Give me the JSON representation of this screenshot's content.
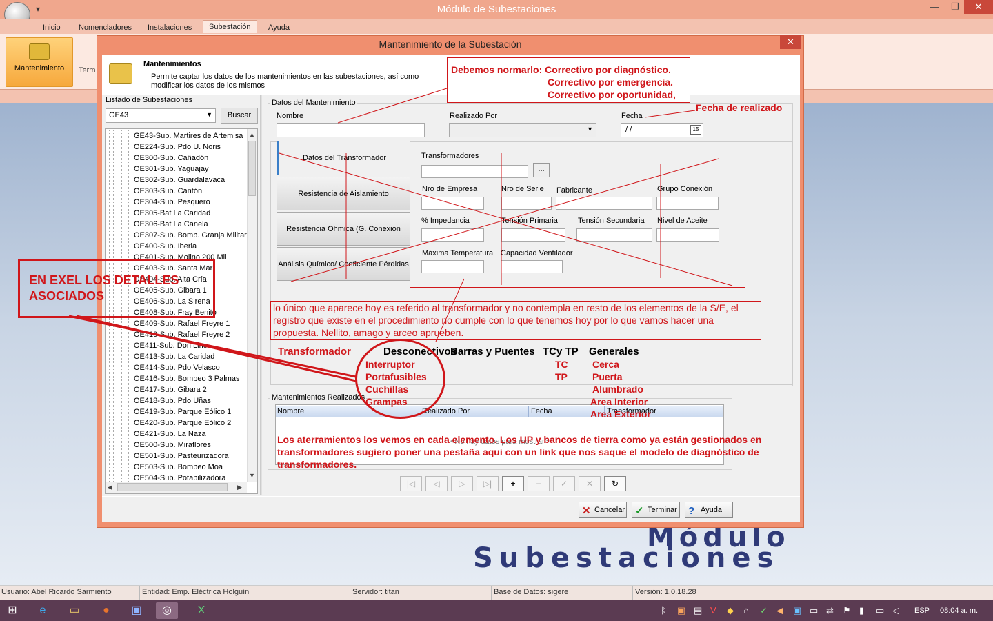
{
  "app": {
    "title": "Módulo de Subestaciones",
    "qat": "▾",
    "ribbon_tabs": [
      "Inicio",
      "Nomencladores",
      "Instalaciones",
      "Subestación",
      "Ayuda"
    ],
    "active_tab": "Subestación",
    "ribbon_buttons": {
      "mantenimiento": "Mantenimiento",
      "term": "Term"
    }
  },
  "dialog": {
    "title": "Mantenimiento de la Subestación",
    "header_title": "Mantenimientos",
    "header_desc": "Permite captar los datos de los mantenimientos en las subestaciones, así como modificar los datos de los mismos",
    "list_label": "Listado de Subestaciones",
    "selected_substation": "GE43",
    "search_button": "Buscar",
    "substations": [
      "GE43-Sub. Martires de Artemisa",
      "OE224-Sub. Pdo U. Noris",
      "OE300-Sub. Cañadón",
      "OE301-Sub. Yaguajay",
      "OE302-Sub. Guardalavaca",
      "OE303-Sub. Cantón",
      "OE304-Sub. Pesquero",
      "OE305-Bat La Caridad",
      "OE306-Bat La Canela",
      "OE307-Sub. Bomb. Granja Militar",
      "OE400-Sub. Iberia",
      "OE401-Sub. Molino 200 Mil",
      "OE403-Sub. Santa Marí",
      "OE404-Sub. Alta Cría",
      "OE405-Sub. Gibara 1",
      "OE406-Sub. La Sirena",
      "OE408-Sub. Fray Benito",
      "OE409-Sub. Rafael Freyre 1",
      "OE410-Sub. Rafael Freyre 2",
      "OE411-Sub. Don Lino",
      "OE413-Sub. La Caridad",
      "OE414-Sub. Pdo Velasco",
      "OE416-Sub. Bombeo 3 Palmas",
      "OE417-Sub. Gibara 2",
      "OE418-Sub. Pdo Uñas",
      "OE419-Sub. Parque Eólico 1",
      "OE420-Sub. Parque Eólico 2",
      "OE421-Sub. La Naza",
      "OE500-Sub. Miraflores",
      "OE501-Sub. Pasteurizadora",
      "OE503-Sub. Bombeo Moa",
      "OE504-Sub. Potabilizadora"
    ],
    "group_datos": "Datos del Mantenimiento",
    "fields": {
      "nombre": "Nombre",
      "realizado_por": "Realizado Por",
      "fecha": "Fecha",
      "fecha_value": "/ /"
    },
    "tabs": [
      "Datos del Transformador",
      "Resistencia de Aislamiento",
      "Resistencia Ohmica (G. Conexion nulo)",
      "Análisis Químico/ Coeficiente Pérdidas"
    ],
    "transformer": {
      "transformadores": "Transformadores",
      "browse": "...",
      "nro_empresa": "Nro de Empresa",
      "nro_serie": "Nro de Serie",
      "fabricante": "Fabricante",
      "grupo_conexion": "Grupo Conexión",
      "impedancia": "% Impedancia",
      "tension_primaria": "Tensión Primaria",
      "tension_secundaria": "Tensión Secundaria",
      "nivel_aceite": "Nivel de Aceite",
      "max_temp": "Máxima Temperatura",
      "cap_ventilador": "Capacidad Ventilador"
    },
    "group_realizados": "Mantenimientos Realizados",
    "grid_headers": [
      "Nombre",
      "Realizado Por",
      "Fecha",
      "Transformador"
    ],
    "grid_empty": "<No hay datos para mostrar>",
    "nav_buttons": [
      "|◁",
      "◁",
      "▷",
      "▷|",
      "+",
      "−",
      "✓",
      "✕",
      "↻"
    ],
    "buttons": {
      "cancel": "Cancelar",
      "finish": "Terminar",
      "help": "Ayuda"
    }
  },
  "annotations": {
    "normarlo": [
      "Debemos normarlo: Correctivo por diagnóstico.",
      "Correctivo por emergencia.",
      "Correctivo por oportunidad,"
    ],
    "fecha": "Fecha de realizado",
    "unico": "lo único que aparece hoy es referido al transformador y no contempla en resto de los elementos de la S/E, el registro que existe en el procedimiento no cumple con lo que tenemos hoy por lo que vamos hacer una propuesta. Nellito, amago y arceo aprueben.",
    "exel": [
      "EN EXEL LOS DETALLES",
      "ASOCIADOS"
    ],
    "columns": {
      "headers": [
        "Transformador",
        "Desconectivos",
        "Barras y Puentes",
        "TCy TP",
        "Generales"
      ],
      "desconectivos": [
        "Interruptor",
        "Portafusibles",
        "Cuchillas",
        "Grampas"
      ],
      "tc_tp": [
        "TC",
        "TP"
      ],
      "generales": [
        "Cerca",
        "Puerta",
        "Alumbrado",
        "Area Interior",
        "Area Exterior"
      ]
    },
    "aterramientos": "Los aterramientos los vemos en cada elemento. Los UP y bancos de tierra como ya están gestionados en transformadores sugiero poner una pestaña aqui con un link que nos saque el modelo de diagnóstico de transformadores."
  },
  "logo": {
    "line1": "Módulo",
    "line2": "Subestaciones"
  },
  "statusbar": {
    "usuario": "Usuario: Abel Ricardo Sarmiento",
    "entidad": "Entidad: Emp. Eléctrica Holguín",
    "servidor": "Servidor: titan",
    "base": "Base de Datos: sigere",
    "version": "Versión: 1.0.18.28"
  },
  "taskbar": {
    "lang": "ESP",
    "clock": "08:04 a. m."
  },
  "colors": {
    "annotation_red": "#d0161a",
    "titlebar": "#f0a78d",
    "dialog_frame": "#f08f6f",
    "taskbar": "#5b3b52"
  }
}
